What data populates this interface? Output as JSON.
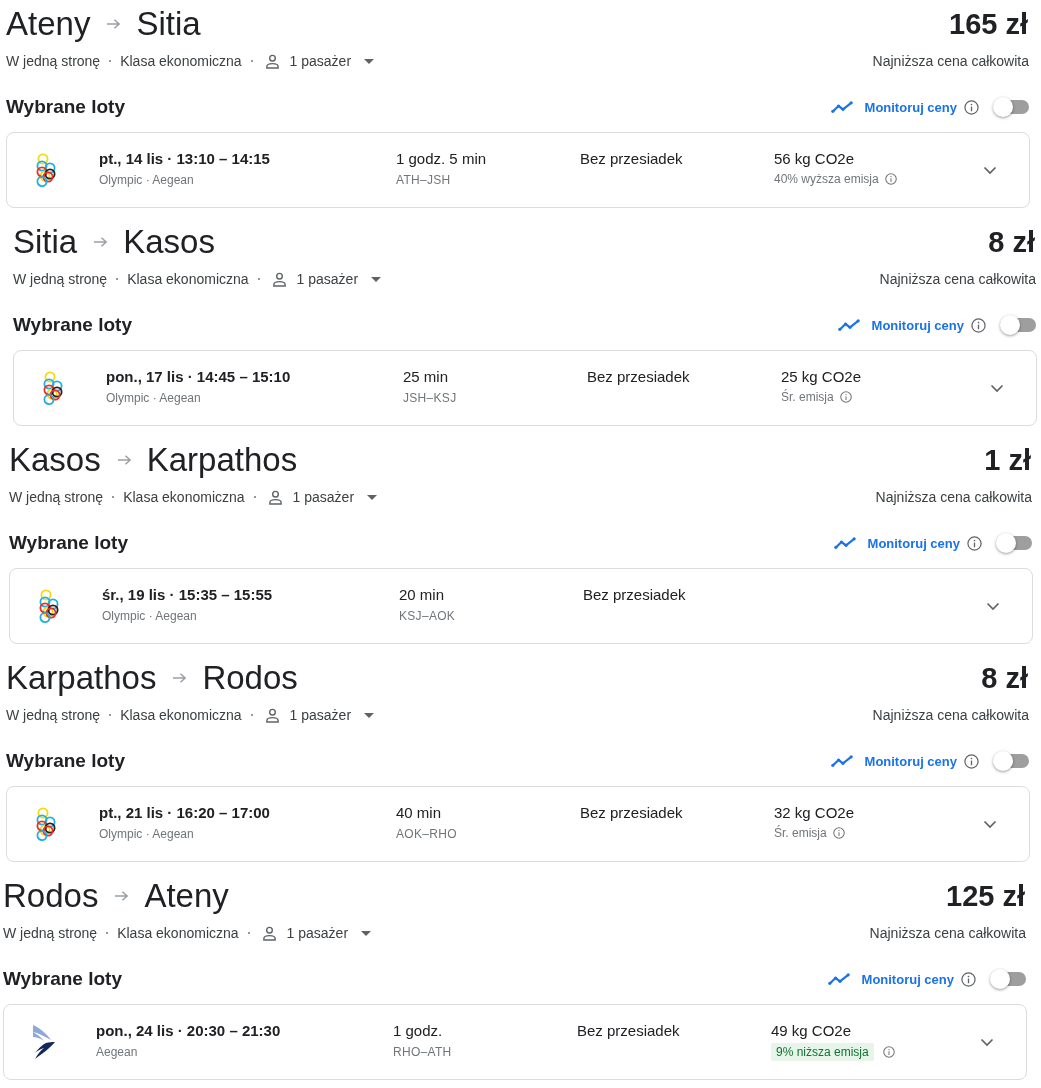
{
  "trips": [
    {
      "from": "Ateny",
      "to": "Sitia",
      "price": "165 zł",
      "price_note": "Najniższa cena całkowita",
      "trip_type": "W jedną stronę",
      "cabin": "Klasa ekonomiczna",
      "passengers": "1 pasażer",
      "section_title": "Wybrane loty",
      "track_prices": {
        "label": "Monitoruj ceny",
        "on": false
      },
      "flight": {
        "logo": {
          "kind": "olympic"
        },
        "date_time": "pt., 14 lis · 13:10 – 14:15",
        "airlines": "Olympic · Aegean",
        "duration": "1 godz. 5 min",
        "route": "ATH–JSH",
        "stops": "Bez przesiadek",
        "emissions": "56 kg CO2e",
        "emission_note": {
          "text": "40% wyższa emisja",
          "highlighted": false
        },
        "expanded": false
      }
    },
    {
      "from": "Sitia",
      "to": "Kasos",
      "price": "8 zł",
      "price_note": "Najniższa cena całkowita",
      "trip_type": "W jedną stronę",
      "cabin": "Klasa ekonomiczna",
      "passengers": "1 pasażer",
      "section_title": "Wybrane loty",
      "track_prices": {
        "label": "Monitoruj ceny",
        "on": false
      },
      "flight": {
        "logo": {
          "kind": "olympic"
        },
        "date_time": "pon., 17 lis · 14:45 – 15:10",
        "airlines": "Olympic · Aegean",
        "duration": "25 min",
        "route": "JSH–KSJ",
        "stops": "Bez przesiadek",
        "emissions": "25 kg CO2e",
        "emission_note": {
          "text": "Śr. emisja",
          "highlighted": false
        },
        "expanded": false
      }
    },
    {
      "from": "Kasos",
      "to": "Karpathos",
      "price": "1 zł",
      "price_note": "Najniższa cena całkowita",
      "trip_type": "W jedną stronę",
      "cabin": "Klasa ekonomiczna",
      "passengers": "1 pasażer",
      "section_title": "Wybrane loty",
      "track_prices": {
        "label": "Monitoruj ceny",
        "on": false
      },
      "flight": {
        "logo": {
          "kind": "olympic"
        },
        "date_time": "śr., 19 lis · 15:35 – 15:55",
        "airlines": "Olympic · Aegean",
        "duration": "20 min",
        "route": "KSJ–AOK",
        "stops": "Bez przesiadek",
        "expanded": false
      }
    },
    {
      "from": "Karpathos",
      "to": "Rodos",
      "price": "8 zł",
      "price_note": "Najniższa cena całkowita",
      "trip_type": "W jedną stronę",
      "cabin": "Klasa ekonomiczna",
      "passengers": "1 pasażer",
      "section_title": "Wybrane loty",
      "track_prices": {
        "label": "Monitoruj ceny",
        "on": false
      },
      "flight": {
        "logo": {
          "kind": "olympic"
        },
        "date_time": "pt., 21 lis · 16:20 – 17:00",
        "airlines": "Olympic · Aegean",
        "duration": "40 min",
        "route": "AOK–RHO",
        "stops": "Bez przesiadek",
        "emissions": "32 kg CO2e",
        "emission_note": {
          "text": "Śr. emisja",
          "highlighted": false
        },
        "expanded": false
      }
    },
    {
      "from": "Rodos",
      "to": "Ateny",
      "price": "125 zł",
      "price_note": "Najniższa cena całkowita",
      "trip_type": "W jedną stronę",
      "cabin": "Klasa ekonomiczna",
      "passengers": "1 pasażer",
      "section_title": "Wybrane loty",
      "track_prices": {
        "label": "Monitoruj ceny",
        "on": false
      },
      "flight": {
        "logo": {
          "kind": "aegean"
        },
        "date_time": "pon., 24 lis · 20:30 – 21:30",
        "airlines": "Aegean",
        "duration": "1 godz.",
        "route": "RHO–ATH",
        "stops": "Bez przesiadek",
        "emissions": "49 kg CO2e",
        "emission_note": {
          "text": "9% niższa emisja",
          "highlighted": true
        },
        "expanded": false
      }
    }
  ]
}
